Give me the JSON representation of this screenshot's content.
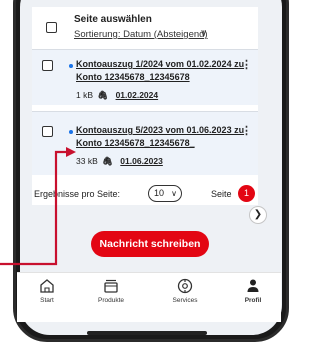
{
  "list": {
    "select_all": {
      "title": "Seite auswählen",
      "sort_label": "Sortierung: Datum (Absteigend)"
    },
    "documents": [
      {
        "title_line1": "Kontoauszug 1/2024 vom 01.02.2024 zu",
        "title_line2": "Konto 12345678_12345678",
        "size": "1 kB",
        "date": "01.02.2024"
      },
      {
        "title_line1": "Kontoauszug 5/2023 vom 01.06.2023 zu",
        "title_line2": "Konto 12345678_12345678_",
        "size": "33 kB",
        "date": "01.06.2023"
      }
    ]
  },
  "pagination": {
    "per_page_label": "Ergebnisse pro Seite:",
    "per_page_value": "10",
    "page_label": "Seite",
    "current_page": "1"
  },
  "cta": {
    "label": "Nachricht schreiben"
  },
  "tabbar": {
    "items": [
      {
        "label": "Start",
        "icon": "home-icon"
      },
      {
        "label": "Produkte",
        "icon": "cards-icon"
      },
      {
        "label": "Services",
        "icon": "services-icon"
      },
      {
        "label": "Profil",
        "icon": "profile-icon"
      }
    ]
  },
  "colors": {
    "accent": "#e30613",
    "link_dot": "#1a73e8",
    "row_bg": "#eef3fa"
  }
}
